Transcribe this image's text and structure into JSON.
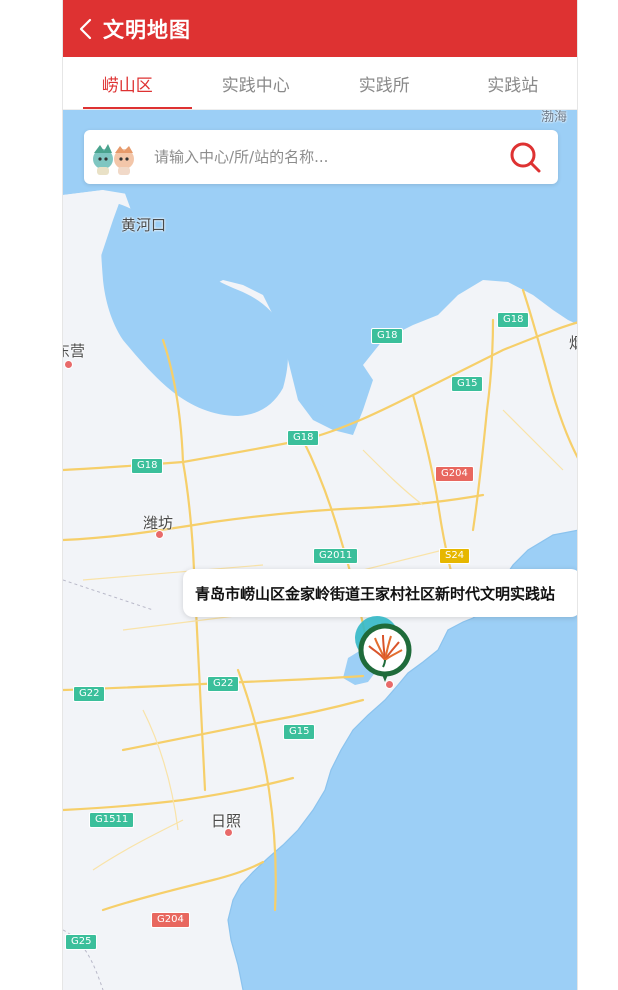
{
  "header": {
    "title": "文明地图"
  },
  "tabs": [
    {
      "label": "崂山区",
      "active": true
    },
    {
      "label": "实践中心",
      "active": false
    },
    {
      "label": "实践所",
      "active": false
    },
    {
      "label": "实践站",
      "active": false
    }
  ],
  "search": {
    "placeholder": "请输入中心/所/站的名称..."
  },
  "map": {
    "places": [
      "黄河口",
      "东营",
      "潍坊",
      "日照"
    ],
    "highways": [
      "G18",
      "G18",
      "G18",
      "G15",
      "G15",
      "G204",
      "G204",
      "G2011",
      "S24",
      "G22",
      "G22",
      "G1511",
      "G25"
    ],
    "corner_label": "渤海",
    "partial_label": "烟"
  },
  "popup": {
    "text": "青岛市崂山区金家岭街道王家村社区新时代文明实践站"
  },
  "colors": {
    "brand": "#de3232",
    "sea": "#9ccff6",
    "land": "#f2f4f8",
    "road": "#f6cf6a"
  },
  "icons": {
    "back": "chevron-left-icon",
    "search": "search-icon",
    "marker": "station-pin-icon",
    "mascot": "mascot-icon"
  }
}
